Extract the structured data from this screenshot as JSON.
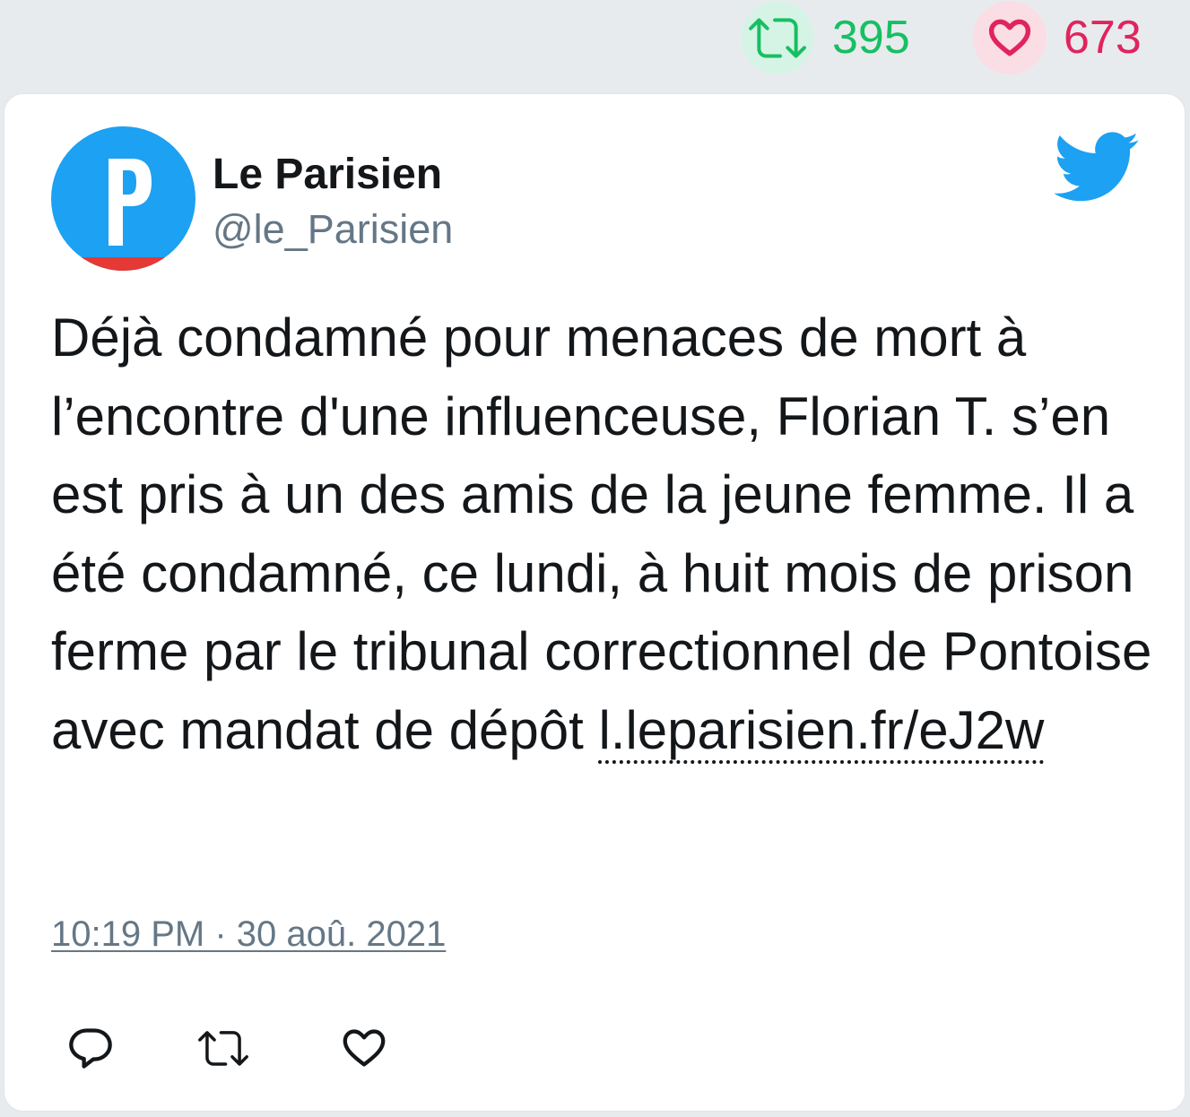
{
  "stats": {
    "retweets": "395",
    "likes": "673",
    "retweet_icon": "retweet-icon",
    "like_icon": "heart-icon",
    "retweet_color": "#17bf63",
    "like_color": "#e0245e"
  },
  "tweet": {
    "author": {
      "name": "Le Parisien",
      "handle": "@le_Parisien",
      "avatar_icon": "le-parisien-logo",
      "avatar_color": "#1da1f2",
      "avatar_stripe_color": "#e53935"
    },
    "brand_icon": "twitter-bird-icon",
    "brand_color": "#1da1f2",
    "text": "Déjà condamné pour menaces de mort à l’encontre d'une influenceuse, Florian T. s’en est pris à un des amis de la jeune femme. Il a été condamné, ce lundi, à huit mois de prison ferme par le tribunal correctionnel de Pontoise avec mandat de dépôt",
    "link": "l.leparisien.fr/eJ2w",
    "timestamp": "10:19 PM · 30 aoû. 2021"
  },
  "actions": [
    {
      "icon": "reply-icon"
    },
    {
      "icon": "retweet-icon"
    },
    {
      "icon": "like-icon"
    }
  ]
}
